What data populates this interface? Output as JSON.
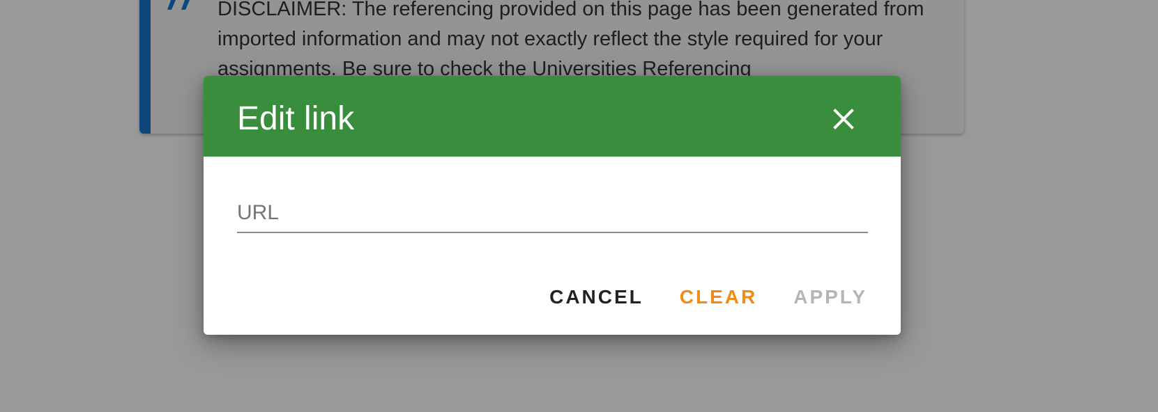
{
  "background": {
    "disclaimer_text": "DISCLAIMER: The referencing provided on this page has been generated from imported information and may not exactly reflect the style required for your assignments. Be sure to check the Universities Referencing",
    "quote_icon": "format-quote-icon",
    "accent_color": "#1976d2"
  },
  "dialog": {
    "title": "Edit link",
    "close_icon": "close-icon",
    "header_color": "#388e3c",
    "url_field": {
      "placeholder": "URL",
      "value": ""
    },
    "actions": {
      "cancel_label": "CANCEL",
      "clear_label": "CLEAR",
      "apply_label": "APPLY",
      "clear_color": "#f38a12",
      "apply_disabled": true
    }
  }
}
